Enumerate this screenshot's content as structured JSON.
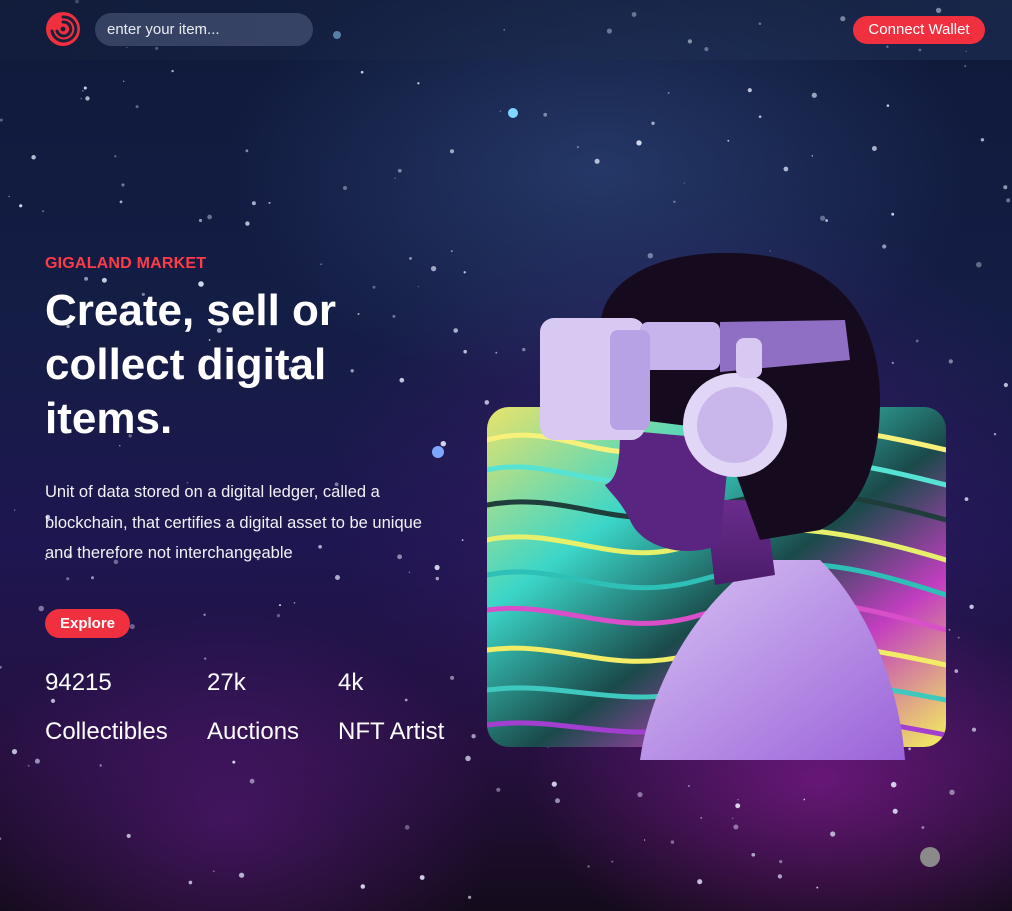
{
  "header": {
    "logo_icon": "swirl-logo-icon",
    "search": {
      "value": "",
      "placeholder": "enter your item..."
    },
    "connect_label": "Connect Wallet"
  },
  "hero": {
    "eyebrow": "GIGALAND MARKET",
    "headline": "Create, sell or collect digital items.",
    "description": "Unit of data stored on a digital ledger, called a blockchain, that certifies a digital asset to be unique and therefore not interchangeable",
    "explore_label": "Explore",
    "stats": [
      {
        "value": "94215",
        "label": "Collectibles"
      },
      {
        "value": "27k",
        "label": "Auctions"
      },
      {
        "value": "4k",
        "label": "NFT Artist"
      }
    ],
    "image_icon": "vr-headset-person-illustration"
  },
  "colors": {
    "accent": "#f0303f",
    "eyebrow": "#ff3b47",
    "background": "#141d45"
  }
}
